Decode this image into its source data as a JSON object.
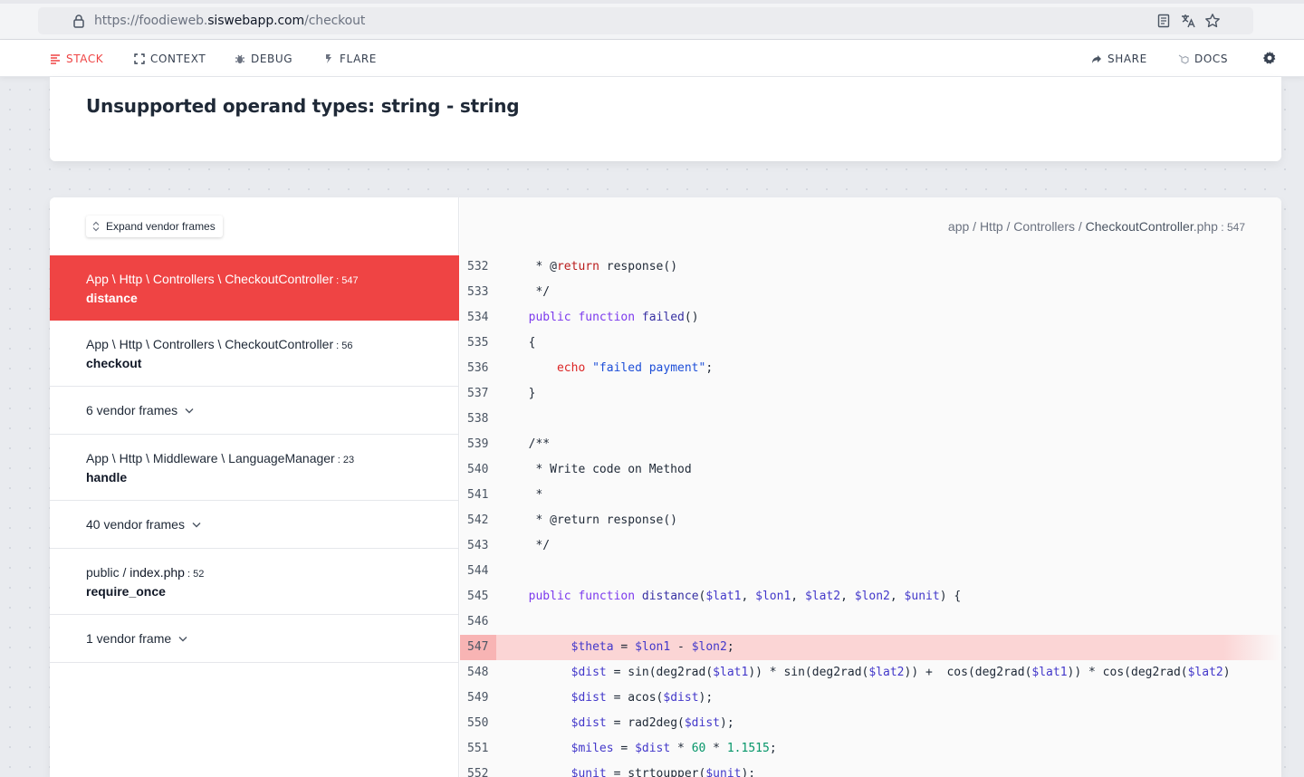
{
  "browser": {
    "url_prefix": "https://foodieweb.",
    "url_domain": "siswebapp.com",
    "url_path": "/checkout"
  },
  "nav": {
    "stack": "STACK",
    "context": "CONTEXT",
    "debug": "DEBUG",
    "flare": "FLARE",
    "share": "SHARE",
    "docs": "DOCS"
  },
  "error": {
    "message": "Unsupported operand types: string - string"
  },
  "stack": {
    "expand_label": "Expand vendor frames",
    "frames": [
      {
        "path": "App \\ Http \\ Controllers \\ CheckoutController",
        "line": " : 547",
        "method": "distance"
      },
      {
        "path": "App \\ Http \\ Controllers \\ CheckoutController",
        "line": " : 56",
        "method": "checkout"
      },
      {
        "vendor": "6 vendor frames"
      },
      {
        "path": "App \\ Http \\ Middleware \\ LanguageManager",
        "line": " : 23",
        "method": "handle"
      },
      {
        "vendor": "40 vendor frames"
      },
      {
        "path_a": "public / ",
        "path_b": "index.php",
        "line": " : 52",
        "method": "require_once"
      },
      {
        "vendor": "1 vendor frame"
      }
    ]
  },
  "code_view": {
    "crumb_dir": "app / Http / Controllers / ",
    "crumb_file": "CheckoutController",
    "crumb_ext": ".php",
    "crumb_line": " : 547",
    "lines": [
      "532",
      "533",
      "534",
      "535",
      "536",
      "537",
      "538",
      "539",
      "540",
      "541",
      "542",
      "543",
      "544",
      "545",
      "546",
      "547",
      "548",
      "549",
      "550",
      "551",
      "552"
    ]
  }
}
